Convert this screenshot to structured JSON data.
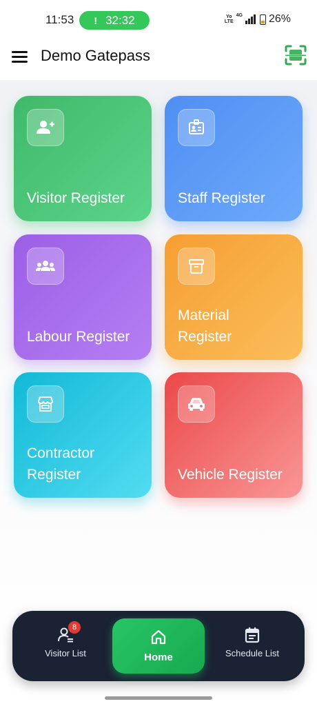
{
  "status_bar": {
    "time": "11:53",
    "call_indicator": "!",
    "call_timer": "32:32",
    "network_top": "Yo",
    "network_bottom": "LTE",
    "network_type": "4G",
    "battery": "26%"
  },
  "app_bar": {
    "title": "Demo Gatepass",
    "menu_icon": "hamburger-menu-icon",
    "scan_icon": "qr-scan-icon",
    "accent_color": "#34a853"
  },
  "cards": [
    {
      "label": "Visitor Register",
      "icon": "person-add-icon",
      "color": "#41b96a"
    },
    {
      "label": "Staff Register",
      "icon": "id-badge-icon",
      "color": "#4f8ff2"
    },
    {
      "label": "Labour Register",
      "icon": "group-icon",
      "color": "#9b5fe6"
    },
    {
      "label": "Material Register",
      "icon": "archive-box-icon",
      "color": "#f59e32"
    },
    {
      "label": "Contractor Register",
      "icon": "storefront-icon",
      "color": "#12b9d6"
    },
    {
      "label": "Vehicle Register",
      "icon": "car-icon",
      "color": "#ec4848"
    }
  ],
  "bottom_nav": {
    "items": [
      {
        "label": "Visitor List",
        "icon": "person-list-icon",
        "badge": "8"
      },
      {
        "label": "Home",
        "icon": "home-icon",
        "active": true
      },
      {
        "label": "Schedule List",
        "icon": "schedule-calendar-icon"
      }
    ],
    "background": "#1a2233",
    "active_color": "#27c566"
  }
}
